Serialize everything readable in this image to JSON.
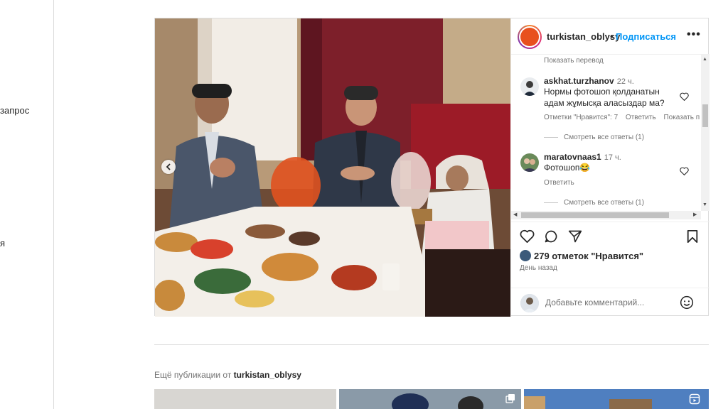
{
  "sidenav": {
    "items": [
      {
        "label": "запрос"
      },
      {
        "label": "я"
      }
    ]
  },
  "post": {
    "account": {
      "username": "turkistan_oblysy",
      "separator": "•",
      "follow_label": "Подписаться",
      "more_icon": "more-horizontal-icon"
    },
    "comments": {
      "show_translation": "Показать перевод",
      "items": [
        {
          "username": "askhat.turzhanov",
          "time": "22 ч.",
          "text": "Нормы фотошоп қолданатын адам жұмысқа аласыздар ма?",
          "likes_label": "Отметки \"Нравится\": 7",
          "reply_label": "Ответить",
          "translate_label": "Показать п",
          "view_replies": "Смотреть все ответы (1)"
        },
        {
          "username": "maratovnaas1",
          "time": "17 ч.",
          "text": "Фотошоп😂",
          "reply_label": "Ответить",
          "view_replies": "Смотреть все ответы (1)"
        }
      ]
    },
    "likes": "279 отметок \"Нравится\"",
    "time_ago": "День назад",
    "add_comment_placeholder": "Добавьте комментарий..."
  },
  "more_posts": {
    "prefix": "Ещё публикации от",
    "username": "turkistan_oblysy"
  },
  "colors": {
    "link_blue": "#0095f6",
    "border": "#dbdbdb",
    "muted": "#737373"
  }
}
